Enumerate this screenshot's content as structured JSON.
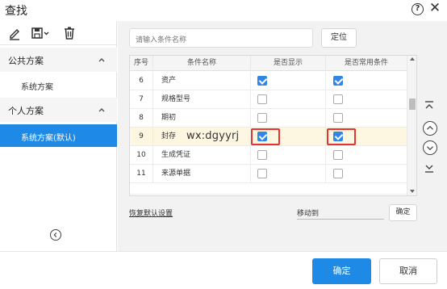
{
  "window": {
    "title": "查找"
  },
  "sidebar": {
    "sections": [
      {
        "title": "公共方案",
        "items": [
          {
            "label": "系统方案",
            "active": false
          }
        ]
      },
      {
        "title": "个人方案",
        "items": [
          {
            "label": "系统方案(默认)",
            "active": true
          }
        ]
      }
    ]
  },
  "search": {
    "placeholder": "请输入条件名称",
    "locate_label": "定位"
  },
  "table": {
    "headers": [
      "序号",
      "条件名称",
      "是否显示",
      "是否常用条件"
    ],
    "rows": [
      {
        "num": "6",
        "name": "资产",
        "show": true,
        "common": true
      },
      {
        "num": "7",
        "name": "规格型号",
        "show": false,
        "common": false
      },
      {
        "num": "8",
        "name": "期初",
        "show": false,
        "common": false
      },
      {
        "num": "9",
        "name": "封存",
        "show": true,
        "common": true,
        "highlight": true
      },
      {
        "num": "10",
        "name": "生成凭证",
        "show": false,
        "common": false
      },
      {
        "num": "11",
        "name": "来源单据",
        "show": false,
        "common": false
      }
    ],
    "watermark": "wx:dgyyrj"
  },
  "bottom": {
    "reset_label": "恢复默认设置",
    "move_label": "移动到",
    "confirm_label": "确定"
  },
  "footer": {
    "ok_label": "确定",
    "cancel_label": "取消"
  },
  "colors": {
    "accent": "#1f8ae6",
    "highlight_row": "#fdf7e2",
    "annotation": "#e3342f"
  }
}
